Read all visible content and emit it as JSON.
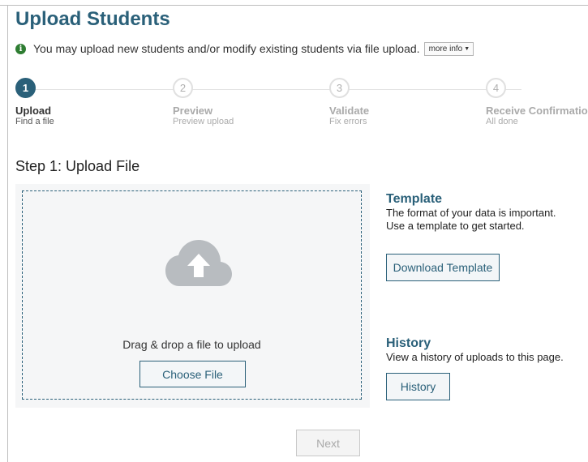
{
  "page": {
    "title": "Upload Students",
    "info_text": "You may upload new students and/or modify existing students via file upload.",
    "more_info_label": "more info"
  },
  "steps": [
    {
      "number": "1",
      "title": "Upload",
      "subtitle": "Find a file",
      "active": true
    },
    {
      "number": "2",
      "title": "Preview",
      "subtitle": "Preview upload",
      "active": false
    },
    {
      "number": "3",
      "title": "Validate",
      "subtitle": "Fix errors",
      "active": false
    },
    {
      "number": "4",
      "title": "Receive Confirmation",
      "subtitle": "All done",
      "active": false
    }
  ],
  "upload": {
    "section_title": "Step 1: Upload File",
    "drop_text": "Drag & drop a file to upload",
    "choose_label": "Choose File"
  },
  "template": {
    "title": "Template",
    "text": "The format of your data is important. Use a template to get started.",
    "button_label": "Download Template"
  },
  "history": {
    "title": "History",
    "text": "View a history of uploads to this page.",
    "button_label": "History"
  },
  "footer": {
    "next_label": "Next",
    "next_disabled": true
  },
  "icons": {
    "info": "info-circle-icon",
    "upload": "cloud-upload-icon",
    "dropdown": "caret-down-icon"
  },
  "colors": {
    "primary": "#2a6079",
    "info_green": "#2e7d32",
    "inactive": "#aaaaaa",
    "panel_bg": "#f5f6f7"
  }
}
